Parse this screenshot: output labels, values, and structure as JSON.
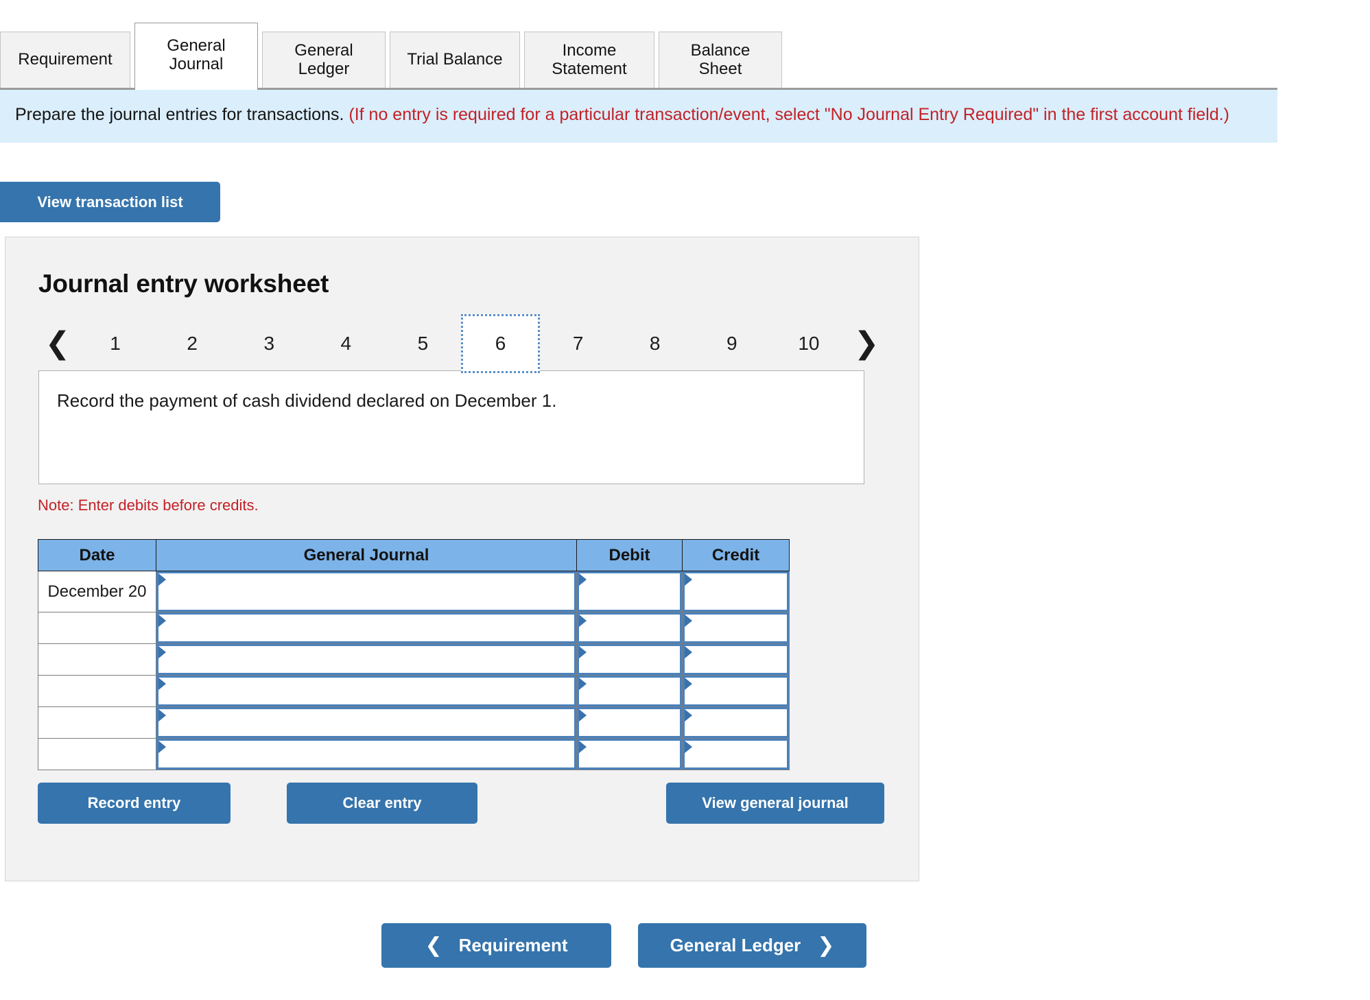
{
  "tabs": [
    {
      "label": "Requirement",
      "active": false
    },
    {
      "label": "General\nJournal",
      "active": true
    },
    {
      "label": "General\nLedger",
      "active": false
    },
    {
      "label": "Trial Balance",
      "active": false
    },
    {
      "label": "Income\nStatement",
      "active": false
    },
    {
      "label": "Balance Sheet",
      "active": false
    }
  ],
  "banner": {
    "main": "Prepare the journal entries for transactions.",
    "hint": "(If no entry is required for a particular transaction/event, select \"No Journal Entry Required\" in the first account field.)"
  },
  "toolbar": {
    "view_transaction_list": "View transaction list"
  },
  "worksheet": {
    "title": "Journal entry worksheet",
    "pager": {
      "prev_icon": "chevron-left",
      "next_icon": "chevron-right",
      "pages": [
        "1",
        "2",
        "3",
        "4",
        "5",
        "6",
        "7",
        "8",
        "9",
        "10"
      ],
      "active_page": "6"
    },
    "description": "Record the payment of cash dividend declared on December 1.",
    "note": "Note: Enter debits before credits.",
    "table": {
      "headers": [
        "Date",
        "General Journal",
        "Debit",
        "Credit"
      ],
      "rows": [
        {
          "date": "December\n20",
          "general_journal": "",
          "debit": "",
          "credit": ""
        },
        {
          "date": "",
          "general_journal": "",
          "debit": "",
          "credit": ""
        },
        {
          "date": "",
          "general_journal": "",
          "debit": "",
          "credit": ""
        },
        {
          "date": "",
          "general_journal": "",
          "debit": "",
          "credit": ""
        },
        {
          "date": "",
          "general_journal": "",
          "debit": "",
          "credit": ""
        },
        {
          "date": "",
          "general_journal": "",
          "debit": "",
          "credit": ""
        }
      ]
    },
    "actions": {
      "record_entry": "Record entry",
      "clear_entry": "Clear entry",
      "view_general_journal": "View general journal"
    }
  },
  "footer_nav": {
    "prev_label": "Requirement",
    "prev_icon": "chevron-left",
    "next_label": "General Ledger",
    "next_icon": "chevron-right"
  },
  "colors": {
    "accent_blue": "#3574ac",
    "table_header_blue": "#7cb3e8",
    "input_border_blue": "#4a82bd",
    "banner_bg": "#dbeefb",
    "hint_red": "#c22127",
    "panel_bg": "#f2f2f2"
  }
}
